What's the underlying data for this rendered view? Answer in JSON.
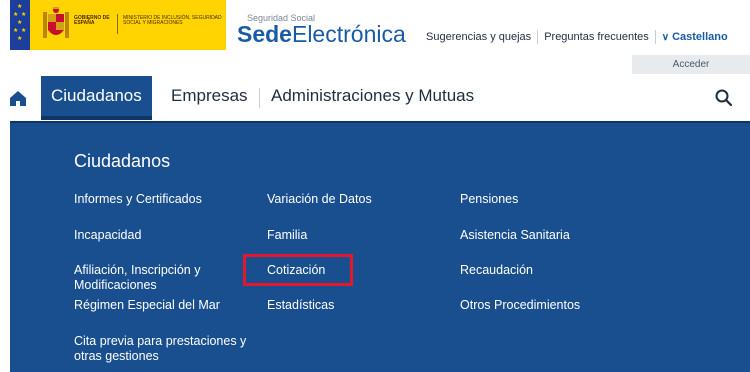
{
  "header": {
    "gov_text": "Gobierno de España",
    "ministry_text": "Ministerio de Inclusión, Seguridad Social y Migraciones",
    "site_subtitle": "Seguridad Social",
    "site_name_bold": "Sede",
    "site_name_light": "Electrónica",
    "links": {
      "suggestions": "Sugerencias y quejas",
      "faq": "Preguntas frecuentes",
      "language": "Castellano"
    },
    "login_label": "Acceder"
  },
  "nav": {
    "items": [
      "Ciudadanos",
      "Empresas",
      "Administraciones y Mutuas"
    ]
  },
  "menu": {
    "title": "Ciudadanos",
    "col1": [
      "Informes y Certificados",
      "Incapacidad",
      "Afiliación, Inscripción y Modificaciones",
      "Régimen Especial del Mar",
      "Cita previa para prestaciones y otras gestiones"
    ],
    "col2": [
      "Variación de Datos",
      "Familia",
      "Cotización",
      "Estadísticas"
    ],
    "col3": [
      "Pensiones",
      "Asistencia Sanitaria",
      "Recaudación",
      "Otros Procedimientos"
    ]
  },
  "colors": {
    "brand_blue": "#1a5ba6",
    "panel_blue": "#1a4f8f",
    "gov_yellow": "#ffd400",
    "highlight_red": "#e3182d"
  },
  "icons": {
    "home": "home-icon",
    "search": "search-icon",
    "language_chevron": "chevron-down-icon"
  }
}
